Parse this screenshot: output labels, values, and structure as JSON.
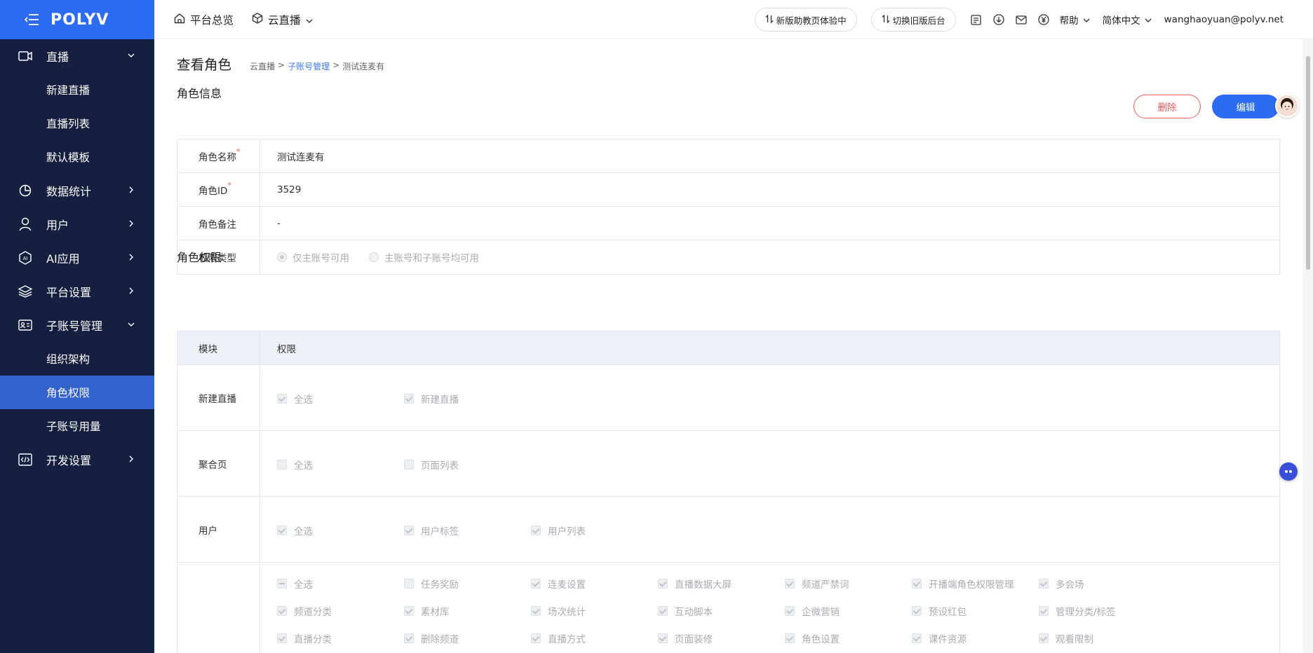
{
  "brand": "POLYV",
  "sidebar": {
    "items": [
      {
        "label": "直播",
        "icon": "video-icon",
        "expanded": true
      },
      {
        "label": "新建直播",
        "sub": true
      },
      {
        "label": "直播列表",
        "sub": true
      },
      {
        "label": "默认模板",
        "sub": true
      },
      {
        "label": "数据统计",
        "icon": "chart-icon"
      },
      {
        "label": "用户",
        "icon": "user-icon"
      },
      {
        "label": "AI应用",
        "icon": "ai-icon"
      },
      {
        "label": "平台设置",
        "icon": "layers-icon"
      },
      {
        "label": "子账号管理",
        "icon": "id-card-icon",
        "expanded": true
      },
      {
        "label": "组织架构",
        "sub": true
      },
      {
        "label": "角色权限",
        "sub": true,
        "active": true
      },
      {
        "label": "子账号用量",
        "sub": true
      },
      {
        "label": "开发设置",
        "icon": "code-icon"
      }
    ]
  },
  "topbar": {
    "overview": "平台总览",
    "cloud_live": "云直播",
    "new_assist": "新版助教页体验中",
    "switch_old": "切换旧版后台",
    "help": "帮助",
    "language": "简体中文",
    "user_email": "wanghaoyuan@polyv.net"
  },
  "page": {
    "title": "查看角色",
    "breadcrumb": [
      "云直播",
      "子账号管理",
      "测试连麦有"
    ]
  },
  "role_info": {
    "section_title": "角色信息",
    "delete_label": "删除",
    "edit_label": "编辑",
    "name_label": "角色名称",
    "name_value": "测试连麦有",
    "id_label": "角色ID",
    "id_value": "3529",
    "note_label": "角色备注",
    "note_value": "-",
    "perm_type_label": "权限类型",
    "perm_type_options": [
      "仅主账号可用",
      "主账号和子账号均可用"
    ],
    "required_mark": "*"
  },
  "role_perms": {
    "section_title": "角色权限",
    "col_module": "模块",
    "col_perm": "权限",
    "rows": [
      {
        "module": "新建直播",
        "items": [
          {
            "label": "全选",
            "state": "checked"
          },
          {
            "label": "新建直播",
            "state": "checked"
          }
        ]
      },
      {
        "module": "聚合页",
        "items": [
          {
            "label": "全选",
            "state": "unchecked"
          },
          {
            "label": "页面列表",
            "state": "unchecked"
          }
        ]
      },
      {
        "module": "用户",
        "items": [
          {
            "label": "全选",
            "state": "checked"
          },
          {
            "label": "用户标签",
            "state": "checked"
          },
          {
            "label": "用户列表",
            "state": "checked"
          }
        ]
      },
      {
        "module": "",
        "items": [
          {
            "label": "全选",
            "state": "indeterminate"
          },
          {
            "label": "任务奖励",
            "state": "unchecked"
          },
          {
            "label": "连麦设置",
            "state": "checked"
          },
          {
            "label": "直播数据大屏",
            "state": "checked"
          },
          {
            "label": "频道严禁词",
            "state": "checked"
          },
          {
            "label": "开播端角色权限管理",
            "state": "checked"
          },
          {
            "label": "多会场",
            "state": "checked"
          },
          {
            "label": "频道分类",
            "state": "checked"
          },
          {
            "label": "素材库",
            "state": "checked"
          },
          {
            "label": "场次统计",
            "state": "checked"
          },
          {
            "label": "互动脚本",
            "state": "checked"
          },
          {
            "label": "企微营销",
            "state": "checked"
          },
          {
            "label": "预设红包",
            "state": "checked"
          },
          {
            "label": "管理分类/标签",
            "state": "checked"
          },
          {
            "label": "直播分类",
            "state": "checked"
          },
          {
            "label": "删除频道",
            "state": "checked"
          },
          {
            "label": "直播方式",
            "state": "checked"
          },
          {
            "label": "页面装修",
            "state": "checked"
          },
          {
            "label": "角色设置",
            "state": "checked"
          },
          {
            "label": "课件资源",
            "state": "checked"
          },
          {
            "label": "观看限制",
            "state": "checked"
          }
        ]
      }
    ]
  }
}
